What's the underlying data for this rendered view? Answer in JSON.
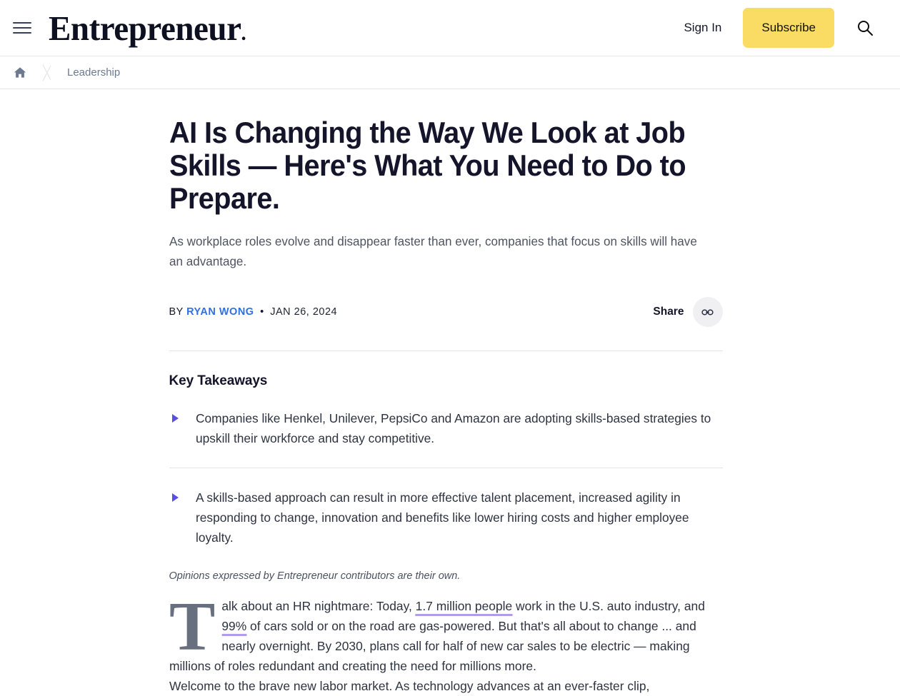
{
  "header": {
    "menu_icon": "hamburger-menu-icon",
    "brand": "Entrepreneur",
    "brand_dot": ".",
    "sign_in": "Sign In",
    "subscribe": "Subscribe",
    "search_icon": "search-icon",
    "subscribe_color": "#fadb63"
  },
  "breadcrumb": {
    "home_icon": "home-icon",
    "category": "Leadership"
  },
  "article": {
    "headline": "AI Is Changing the Way We Look at Job Skills — Here's What You Need to Do to Prepare.",
    "standfirst": "As workplace roles evolve and disappear faster than ever, companies that focus on skills will have an advantage.",
    "byline_prefix": "BY",
    "author": "RYAN WONG",
    "separator": "•",
    "date": "JAN 26, 2024",
    "share_label": "Share",
    "share_icon": "link-icon",
    "author_color": "#2f6fe4"
  },
  "takeaways": {
    "title": "Key Takeaways",
    "bullet_color": "#5b4fe0",
    "items": [
      "Companies like Henkel, Unilever, PepsiCo and Amazon are adopting skills-based strategies to upskill their workforce and stay competitive.",
      "A skills-based approach can result in more effective talent placement, increased agility in responding to change, innovation and benefits like lower hiring costs and higher employee loyalty."
    ]
  },
  "body": {
    "disclaimer": "Opinions expressed by Entrepreneur contributors are their own.",
    "dropcap": "T",
    "p1_a": "alk about an HR nightmare: Today, ",
    "link1": "1.7 million people",
    "p1_b": " work in the U.S. auto industry, and ",
    "link2": "99%",
    "p1_c": " of cars sold or on the road are gas-powered. But that's all about to change ... and nearly overnight. By 2030, plans call for half of new car sales to be electric — making millions of roles redundant and creating the need for millions more.",
    "p2": "Welcome to the brave new labor market. As technology advances at an ever-faster clip,",
    "link_underline_color": "#b19ce8"
  }
}
